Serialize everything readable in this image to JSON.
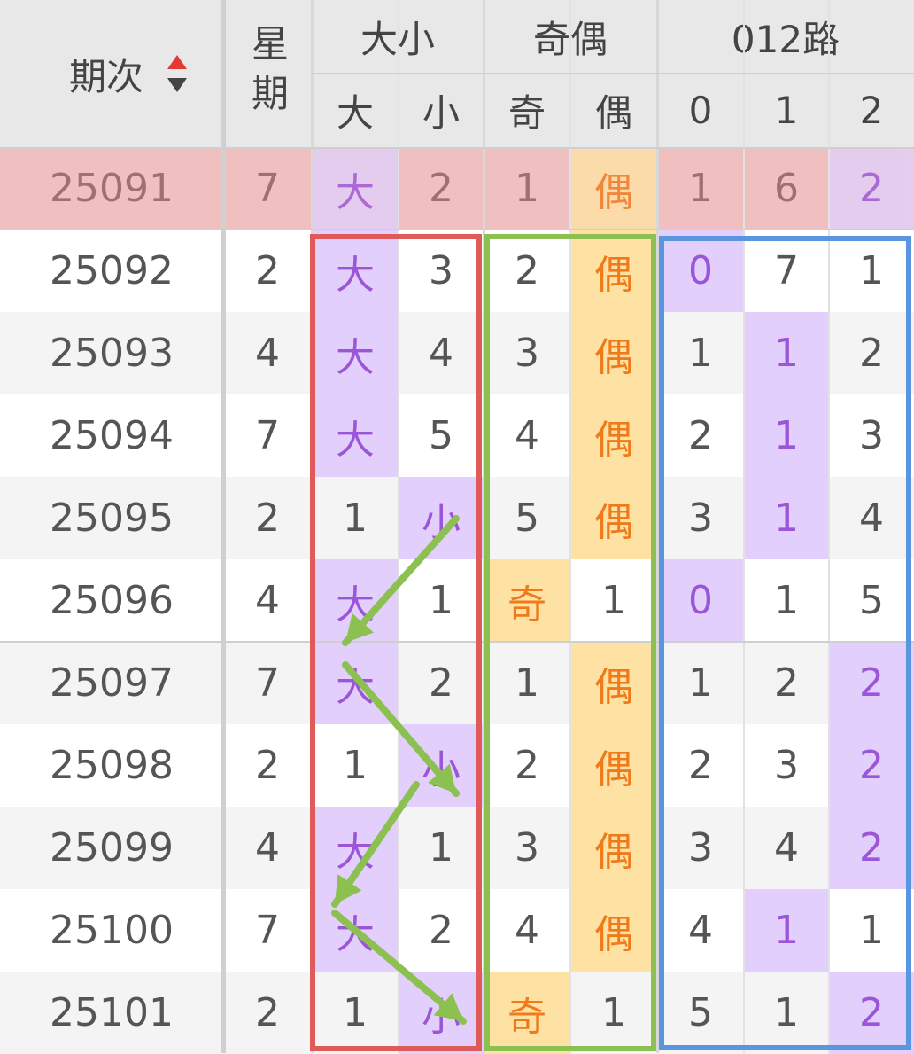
{
  "header": {
    "period_label": "期次",
    "weekday_label": "星期",
    "groups": [
      {
        "label": "大小",
        "subs": [
          "大",
          "小"
        ]
      },
      {
        "label": "奇偶",
        "subs": [
          "奇",
          "偶"
        ]
      },
      {
        "label": "012路",
        "subs": [
          "0",
          "1",
          "2"
        ]
      }
    ],
    "sort_icon": "sort-up-down-icon"
  },
  "rows": [
    {
      "period": "25091",
      "weekday": "7",
      "cells": [
        "大",
        "2",
        "1",
        "偶",
        "1",
        "6",
        "2"
      ],
      "hits": [
        0,
        3,
        6
      ],
      "highlight": true
    },
    {
      "period": "25092",
      "weekday": "2",
      "cells": [
        "大",
        "3",
        "2",
        "偶",
        "0",
        "7",
        "1"
      ],
      "hits": [
        0,
        3,
        4
      ]
    },
    {
      "period": "25093",
      "weekday": "4",
      "cells": [
        "大",
        "4",
        "3",
        "偶",
        "1",
        "1",
        "2"
      ],
      "hits": [
        0,
        3,
        5
      ]
    },
    {
      "period": "25094",
      "weekday": "7",
      "cells": [
        "大",
        "5",
        "4",
        "偶",
        "2",
        "1",
        "3"
      ],
      "hits": [
        0,
        3,
        5
      ]
    },
    {
      "period": "25095",
      "weekday": "2",
      "cells": [
        "1",
        "小",
        "5",
        "偶",
        "3",
        "1",
        "4"
      ],
      "hits": [
        1,
        3,
        5
      ]
    },
    {
      "period": "25096",
      "weekday": "4",
      "cells": [
        "大",
        "1",
        "奇",
        "1",
        "0",
        "1",
        "5"
      ],
      "hits": [
        0,
        2,
        4
      ]
    },
    {
      "period": "25097",
      "weekday": "7",
      "cells": [
        "大",
        "2",
        "1",
        "偶",
        "1",
        "2",
        "2"
      ],
      "hits": [
        0,
        3,
        6
      ]
    },
    {
      "period": "25098",
      "weekday": "2",
      "cells": [
        "1",
        "小",
        "2",
        "偶",
        "2",
        "3",
        "2"
      ],
      "hits": [
        1,
        3,
        6
      ]
    },
    {
      "period": "25099",
      "weekday": "4",
      "cells": [
        "大",
        "1",
        "3",
        "偶",
        "3",
        "4",
        "2"
      ],
      "hits": [
        0,
        3,
        6
      ]
    },
    {
      "period": "25100",
      "weekday": "7",
      "cells": [
        "大",
        "2",
        "4",
        "偶",
        "4",
        "1",
        "1"
      ],
      "hits": [
        0,
        3,
        5
      ]
    },
    {
      "period": "25101",
      "weekday": "2",
      "cells": [
        "1",
        "小",
        "奇",
        "1",
        "5",
        "1",
        "2"
      ],
      "hits": [
        1,
        2,
        6
      ]
    }
  ],
  "colors": {
    "header_bg": "#e8e8e8",
    "row_alt_bg": "#f4f4f4",
    "highlight_row_bg": "#f0c0c0",
    "purple_hit_bg": "#e2cffb",
    "purple_text": "#9a55d8",
    "orange_hit_bg": "#fde2a4",
    "orange_text": "#f07a1a",
    "red_box": "#e05a5a",
    "green_box": "#8cc152",
    "blue_box": "#5a96e0",
    "arrow": "#8cc152"
  }
}
